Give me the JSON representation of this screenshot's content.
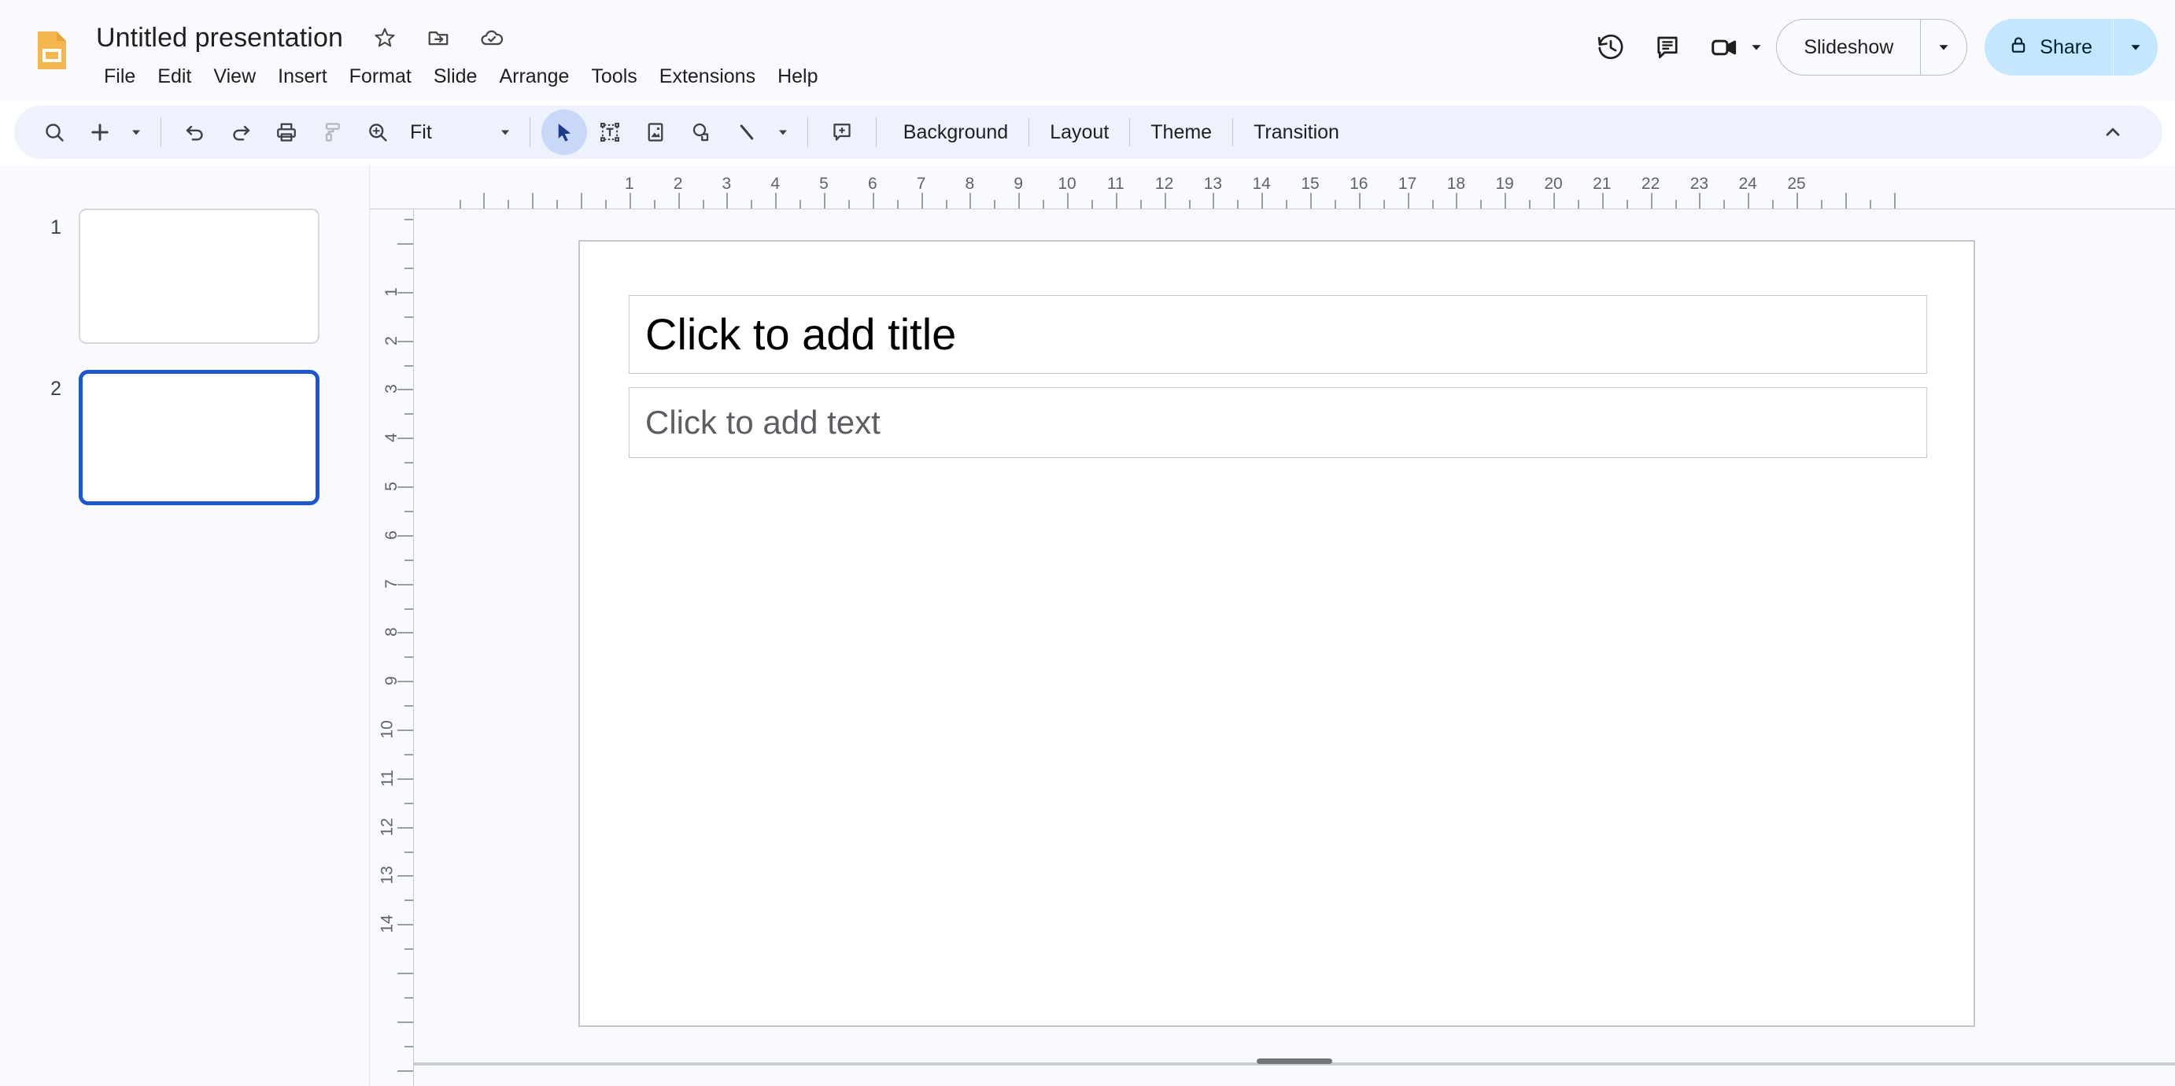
{
  "app": {
    "logo_icon": "slides-logo-icon",
    "accent_blue": "#1a56d6",
    "share_bg": "#c2e7ff",
    "toolbar_bg": "#edf2fc"
  },
  "header": {
    "doc_title": "Untitled presentation",
    "title_icons": [
      {
        "name": "star-icon",
        "glyph": "star"
      },
      {
        "name": "move-to-folder-icon",
        "glyph": "folder-move"
      },
      {
        "name": "saved-to-drive-icon",
        "glyph": "cloud-check"
      }
    ],
    "menus": [
      "File",
      "Edit",
      "View",
      "Insert",
      "Format",
      "Slide",
      "Arrange",
      "Tools",
      "Extensions",
      "Help"
    ],
    "right_icons": [
      {
        "name": "version-history-icon",
        "glyph": "history"
      },
      {
        "name": "comment-history-icon",
        "glyph": "comment"
      },
      {
        "name": "meet-camera-icon",
        "glyph": "video-camera"
      }
    ],
    "slideshow_label": "Slideshow",
    "share_label": "Share"
  },
  "toolbar": {
    "items": [
      {
        "name": "search-button",
        "type": "icon",
        "icon": "search-icon"
      },
      {
        "name": "new-slide-button",
        "type": "icon",
        "icon": "plus-icon"
      },
      {
        "name": "new-slide-dropdown",
        "type": "caret",
        "icon": "chevron-down-icon"
      },
      {
        "name": "separator-1",
        "type": "separator"
      },
      {
        "name": "undo-button",
        "type": "icon",
        "icon": "undo-icon"
      },
      {
        "name": "redo-button",
        "type": "icon",
        "icon": "redo-icon"
      },
      {
        "name": "print-button",
        "type": "icon",
        "icon": "print-icon"
      },
      {
        "name": "paint-format-button",
        "type": "icon",
        "icon": "paint-roller-icon",
        "disabled": true
      },
      {
        "name": "zoom-button",
        "type": "icon",
        "icon": "zoom-in-icon"
      }
    ],
    "zoom_value": "Fit",
    "tools": [
      {
        "name": "select-tool-button",
        "icon": "cursor-arrow-icon",
        "active": true
      },
      {
        "name": "text-box-button",
        "icon": "text-box-icon"
      },
      {
        "name": "insert-image-button",
        "icon": "image-icon"
      },
      {
        "name": "insert-shape-button",
        "icon": "shape-icon"
      },
      {
        "name": "insert-line-button",
        "icon": "line-icon"
      }
    ],
    "line_dropdown_icon": "chevron-down-icon",
    "comment_icon": "add-comment-icon",
    "text_buttons": [
      "Background",
      "Layout",
      "Theme",
      "Transition"
    ],
    "collapse_icon": "chevron-up-icon"
  },
  "filmstrip": {
    "slides": [
      {
        "number": "1",
        "selected": false
      },
      {
        "number": "2",
        "selected": true
      }
    ]
  },
  "rulers": {
    "horizontal_numbers": [
      "1",
      "2",
      "3",
      "4",
      "5",
      "6",
      "7",
      "8",
      "9",
      "10",
      "11",
      "12",
      "13",
      "14",
      "15",
      "16",
      "17",
      "18",
      "19",
      "20",
      "21",
      "22",
      "23",
      "24",
      "25"
    ],
    "vertical_numbers": [
      "1",
      "2",
      "3",
      "4",
      "5",
      "6",
      "7",
      "8",
      "9",
      "10",
      "11",
      "12",
      "13",
      "14"
    ]
  },
  "slide": {
    "title_placeholder": "Click to add title",
    "body_placeholder": "Click to add text"
  }
}
